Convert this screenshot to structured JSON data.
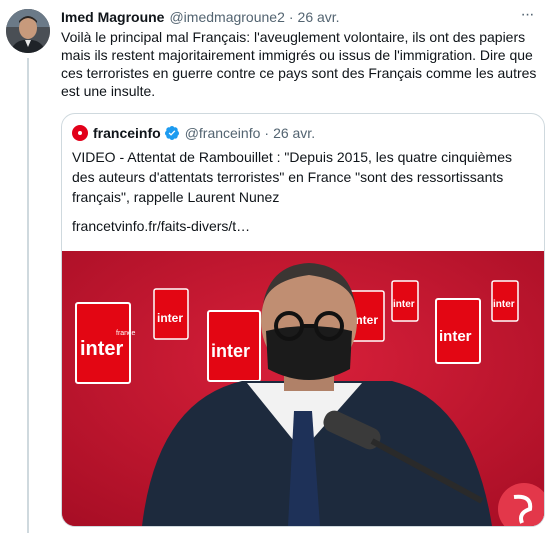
{
  "tweet": {
    "author_name": "Imed Magroune",
    "author_handle": "@imedmagroune2",
    "separator": "·",
    "time": "26 avr.",
    "more_label": "···",
    "text": "Voilà le principal mal Français: l'aveuglement volontaire, ils ont des papiers mais ils restent majoritairement immigrés ou issus de l'immigration. Dire que ces terroristes en guerre contre ce pays sont des Français comme les autres est une insulte."
  },
  "quote": {
    "author_name": "franceinfo",
    "author_handle": "@franceinfo",
    "separator": "·",
    "time": "26 avr.",
    "text": "VIDEO - Attentat de Rambouillet : \"Depuis 2015, les quatre cinquièmes des auteurs d'attentats terroristes\" en France \"sont des ressortissants français\", rappelle Laurent Nunez",
    "link": "francetvinfo.fr/faits-divers/t…",
    "media": {
      "logo_word": "inter",
      "logo_small": "france"
    }
  },
  "colors": {
    "brand_red": "#e2001a",
    "verified_blue": "#1d9bf0",
    "secondary_text": "#536471",
    "border": "#cfd9de"
  },
  "icons": {
    "more": "more-horizontal-icon",
    "verified": "verified-badge-icon",
    "franceinfo_logo": "franceinfo-logo-icon"
  }
}
